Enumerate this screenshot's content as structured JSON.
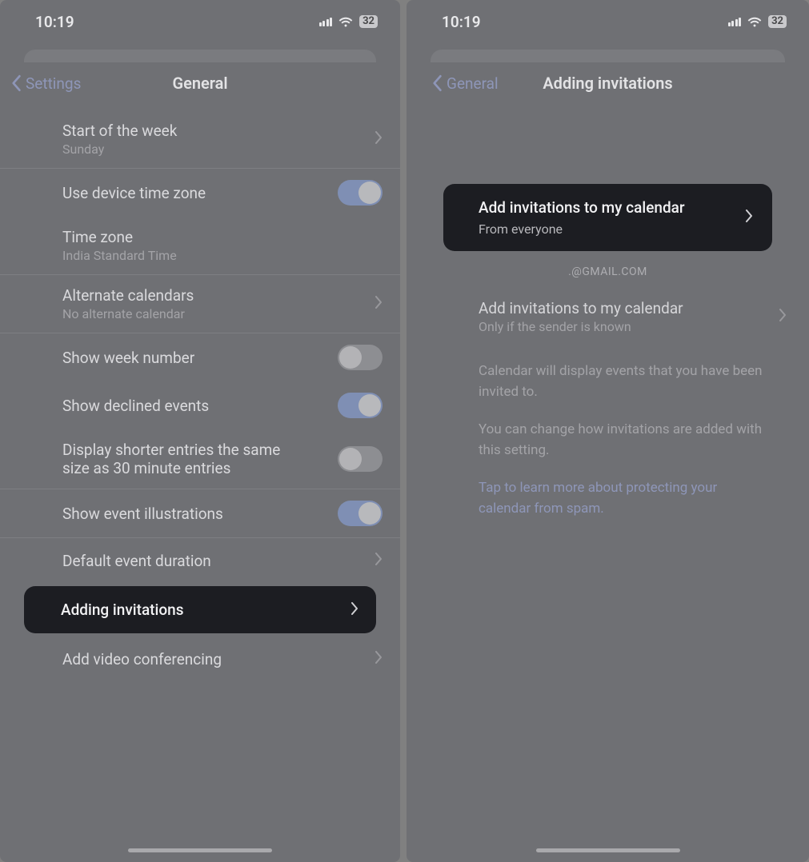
{
  "status": {
    "time": "10:19",
    "battery": "32"
  },
  "left": {
    "back_label": "Settings",
    "title": "General",
    "rows": {
      "start_week": {
        "title": "Start of the week",
        "sub": "Sunday"
      },
      "device_tz": {
        "title": "Use device time zone"
      },
      "timezone": {
        "title": "Time zone",
        "sub": "India Standard Time"
      },
      "alt_cal": {
        "title": "Alternate calendars",
        "sub": "No alternate calendar"
      },
      "week_num": {
        "title": "Show week number"
      },
      "declined": {
        "title": "Show declined events"
      },
      "shorter": {
        "title": "Display shorter entries the same size as 30 minute entries"
      },
      "illus": {
        "title": "Show event illustrations"
      },
      "def_dur": {
        "title": "Default event duration"
      },
      "adding": {
        "title": "Adding invitations"
      },
      "video": {
        "title": "Add video conferencing"
      }
    }
  },
  "right": {
    "back_label": "General",
    "title": "Adding invitations",
    "primary": {
      "title": "Add invitations to my calendar",
      "sub": "From everyone"
    },
    "section_header": ".@GMAIL.COM",
    "gmail_row": {
      "title": "Add invitations to my calendar",
      "sub": "Only if the sender is known"
    },
    "desc1": "Calendar will display events that you have been invited to.",
    "desc2": "You can change how invitations are added with this setting.",
    "link": "Tap to learn more about protecting your calendar from spam."
  }
}
